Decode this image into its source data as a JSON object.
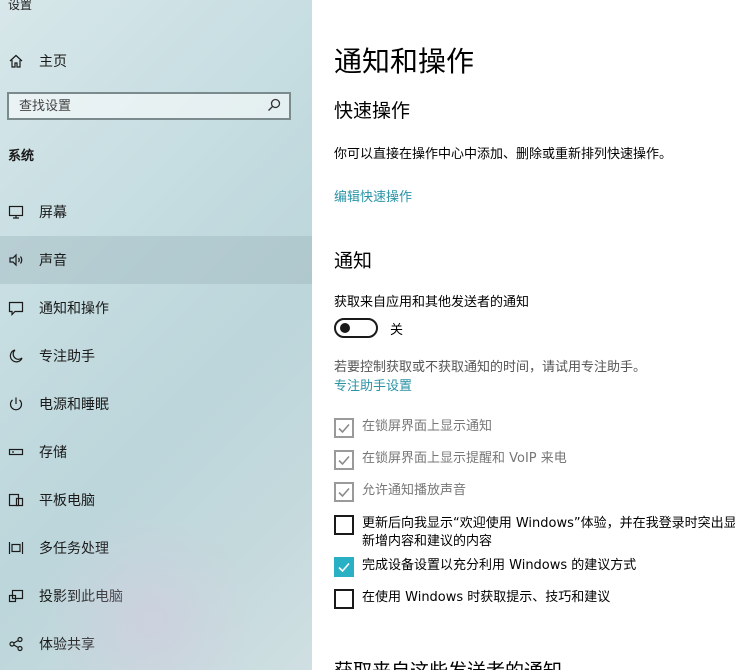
{
  "app": {
    "title": "设置"
  },
  "sidebar": {
    "home_label": "主页",
    "search_placeholder": "查找设置",
    "section_label": "系统",
    "items": [
      {
        "label": "屏幕",
        "icon": "monitor-icon"
      },
      {
        "label": "声音",
        "icon": "speaker-icon",
        "active": true
      },
      {
        "label": "通知和操作",
        "icon": "notification-icon"
      },
      {
        "label": "专注助手",
        "icon": "moon-icon"
      },
      {
        "label": "电源和睡眠",
        "icon": "power-icon"
      },
      {
        "label": "存储",
        "icon": "storage-icon"
      },
      {
        "label": "平板电脑",
        "icon": "tablet-icon"
      },
      {
        "label": "多任务处理",
        "icon": "multitask-icon"
      },
      {
        "label": "投影到此电脑",
        "icon": "project-icon"
      },
      {
        "label": "体验共享",
        "icon": "share-icon"
      }
    ]
  },
  "main": {
    "title": "通知和操作",
    "quick_actions": {
      "heading": "快速操作",
      "description": "你可以直接在操作中心中添加、删除或重新排列快速操作。",
      "link": "编辑快速操作"
    },
    "notifications": {
      "heading": "通知",
      "toggle_label": "获取来自应用和其他发送者的通知",
      "toggle_state": "关",
      "toggle_on": false,
      "hint": "若要控制获取或不获取通知的时间，请试用专注助手。",
      "hint_link": "专注助手设置",
      "checkboxes": [
        {
          "label": "在锁屏界面上显示通知",
          "checked": true,
          "disabled": true
        },
        {
          "label": "在锁屏界面上显示提醒和 VoIP 来电",
          "checked": true,
          "disabled": true
        },
        {
          "label": "允许通知播放声音",
          "checked": true,
          "disabled": true
        },
        {
          "label": "更新后向我显示“欢迎使用 Windows”体验，并在我登录时突出显示新增内容和建议的内容",
          "checked": false,
          "disabled": false
        },
        {
          "label": "完成设备设置以充分利用 Windows 的建议方式",
          "checked": true,
          "disabled": false
        },
        {
          "label": "在使用 Windows 时获取提示、技巧和建议",
          "checked": false,
          "disabled": false
        }
      ]
    },
    "bottom_heading": "获取来自这些发送者的通知"
  },
  "colors": {
    "accent": "#2ab0c4",
    "link": "#2a93a6"
  }
}
